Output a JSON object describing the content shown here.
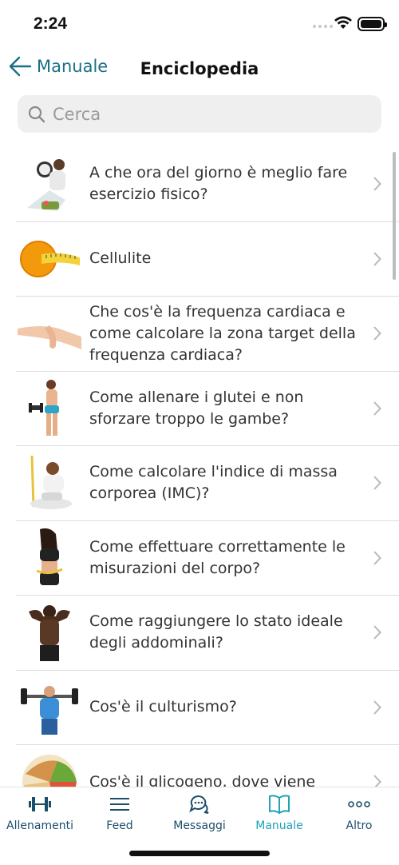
{
  "status_bar": {
    "time": "2:24"
  },
  "nav": {
    "back_label": "Manuale",
    "title": "Enciclopedia"
  },
  "search": {
    "placeholder": "Cerca"
  },
  "articles": [
    {
      "title": "A che ora del giorno è meglio fare esercizio fisico?",
      "thumb": "woman-clock"
    },
    {
      "title": "Cellulite",
      "thumb": "orange-tape"
    },
    {
      "title": "Che cos'è la frequenza cardiaca e come calcolare la zona target della frequenza cardiaca?",
      "thumb": "wrist-pulse"
    },
    {
      "title": "Come allenare i glutei e non sforzare troppo le gambe?",
      "thumb": "woman-dumbbell"
    },
    {
      "title": "Come calcolare l'indice di massa corporea (IMC)?",
      "thumb": "woman-scale"
    },
    {
      "title": "Come effettuare correttamente le misurazioni del corpo?",
      "thumb": "woman-measuring"
    },
    {
      "title": "Come raggiungere lo stato ideale degli addominali?",
      "thumb": "man-abs"
    },
    {
      "title": "Cos'è il culturismo?",
      "thumb": "man-barbell"
    },
    {
      "title": "Cos'è il glicogeno, dove viene",
      "thumb": "food-plate"
    }
  ],
  "tabs": [
    {
      "label": "Allenamenti",
      "icon": "dumbbell-icon",
      "active": false
    },
    {
      "label": "Feed",
      "icon": "menu-lines-icon",
      "active": false
    },
    {
      "label": "Messaggi",
      "icon": "chat-bubbles-icon",
      "active": false
    },
    {
      "label": "Manuale",
      "icon": "open-book-icon",
      "active": true
    },
    {
      "label": "Altro",
      "icon": "more-dots-icon",
      "active": false
    }
  ],
  "colors": {
    "accent": "#1fa3b5",
    "nav_blue": "#1a6e86",
    "tab_inactive": "#1a4e6a"
  }
}
